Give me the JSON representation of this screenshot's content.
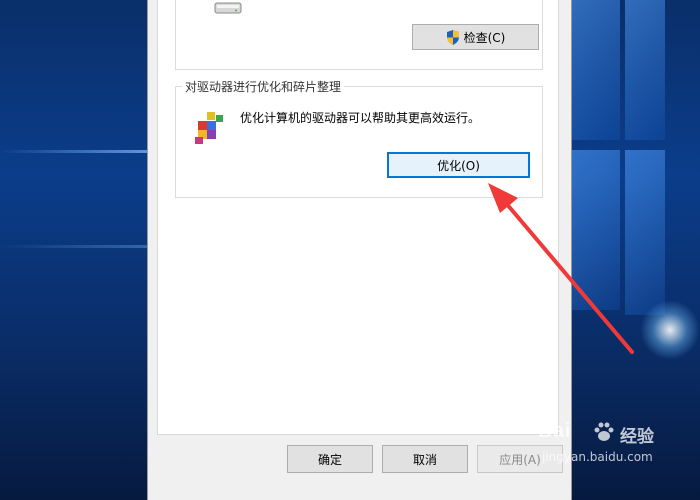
{
  "check_group": {
    "check_button_label": "检查(C)"
  },
  "optimize_group": {
    "title": "对驱动器进行优化和碎片整理",
    "description": "优化计算机的驱动器可以帮助其更高效运行。",
    "optimize_button_label": "优化(O)"
  },
  "footer": {
    "ok_label": "确定",
    "cancel_label": "取消",
    "apply_label": "应用(A)"
  },
  "watermark": {
    "brand_left": "Bai",
    "brand_right": "经验",
    "url": "jingyan.baidu.com"
  },
  "colors": {
    "annotation_arrow": "#f03a3a",
    "focus_border": "#0078d7"
  },
  "icons": [
    "drive-icon",
    "uac-shield-icon",
    "defrag-icon",
    "baidu-paw-icon"
  ]
}
